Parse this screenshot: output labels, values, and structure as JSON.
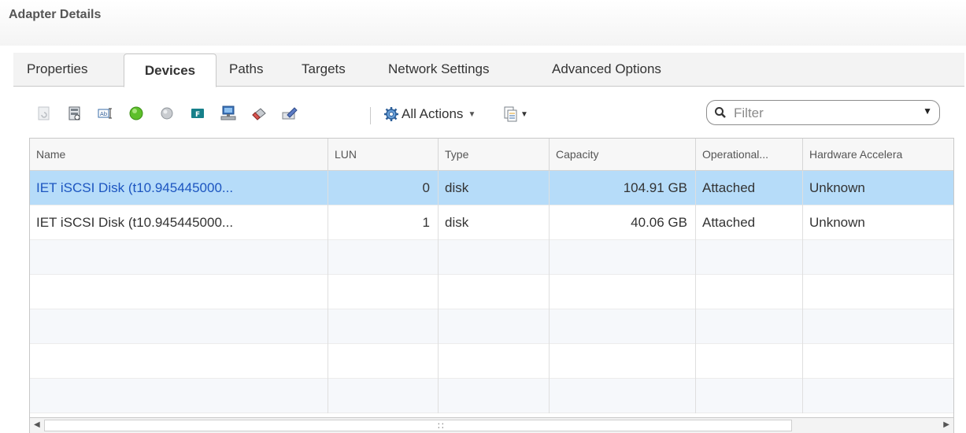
{
  "page": {
    "title": "Adapter Details"
  },
  "tabs": [
    {
      "label": "Properties",
      "active": false
    },
    {
      "label": "Devices",
      "active": true
    },
    {
      "label": "Paths",
      "active": false
    },
    {
      "label": "Targets",
      "active": false
    },
    {
      "label": "Network Settings",
      "active": false
    },
    {
      "label": "Advanced Options",
      "active": false
    }
  ],
  "toolbar": {
    "icons": [
      "refresh-disabled-icon",
      "rescan-storage-icon",
      "rename-icon",
      "turn-on-led-icon",
      "turn-off-led-icon",
      "flash-mark-icon",
      "host-device-icon",
      "erase-partitions-icon",
      "pencil-edit-icon"
    ],
    "all_actions_label": "All Actions",
    "filter_placeholder": "Filter"
  },
  "table": {
    "columns": [
      "Name",
      "LUN",
      "Type",
      "Capacity",
      "Operational...",
      "Hardware Accelera"
    ],
    "rows": [
      {
        "name": "IET iSCSI Disk (t10.945445000...",
        "lun": "0",
        "type": "disk",
        "capacity": "104.91 GB",
        "operational": "Attached",
        "hw_accel": "Unknown",
        "selected": true
      },
      {
        "name": "IET iSCSI Disk (t10.945445000...",
        "lun": "1",
        "type": "disk",
        "capacity": "40.06 GB",
        "operational": "Attached",
        "hw_accel": "Unknown",
        "selected": false
      }
    ]
  },
  "colors": {
    "selected_row": "#b6dcf9",
    "selected_text": "#1c55c0",
    "led_on": "#4caf20"
  }
}
